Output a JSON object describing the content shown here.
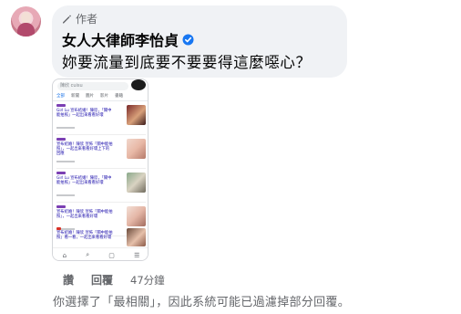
{
  "author_badge": "作者",
  "commenter_name": "女人大律師李怡貞",
  "comment_text": "妳要流量到底要不要要得這麼噁心？",
  "screenshot_search_text": "陳欣 cuisu",
  "screenshot_tabs": [
    "全部",
    "新聞",
    "圖片",
    "影片",
    "書籍"
  ],
  "screenshot_results": [
    {
      "title": "Girl Lu 宣布結婚！陳欣，「關中能拍照」一起出來看看好壞"
    },
    {
      "title": "宣布結婚！陳欣 宣佈「關中能拍照」，一起出來看看好壞上下的回應"
    },
    {
      "title": "Girl Lu 宣布結婚！陳欣，「關中能拍照」一起出來看看好壞"
    },
    {
      "title": "宣布結婚！陳欣 宣佈「關中能拍照」，一起出來看看好壞"
    },
    {
      "title": "宣布結婚！陳欣 宣佈「關中能拍照」看一看，一起出來看看好壞"
    }
  ],
  "screenshot_nav": [
    "⌂",
    "⌕",
    "▢",
    "☰"
  ],
  "actions": {
    "like_label": "讚",
    "reply_label": "回覆",
    "timestamp": "47分鐘"
  },
  "filter_notice": "你選擇了「最相關」，因此系統可能已過濾掉部分回覆。",
  "colors": {
    "bubble_bg": "#f0f2f5",
    "verified_blue": "#1877f2",
    "secondary_text": "#65676b"
  },
  "icons": {
    "author": "pencil-icon",
    "verified": "verified-badge-icon"
  }
}
